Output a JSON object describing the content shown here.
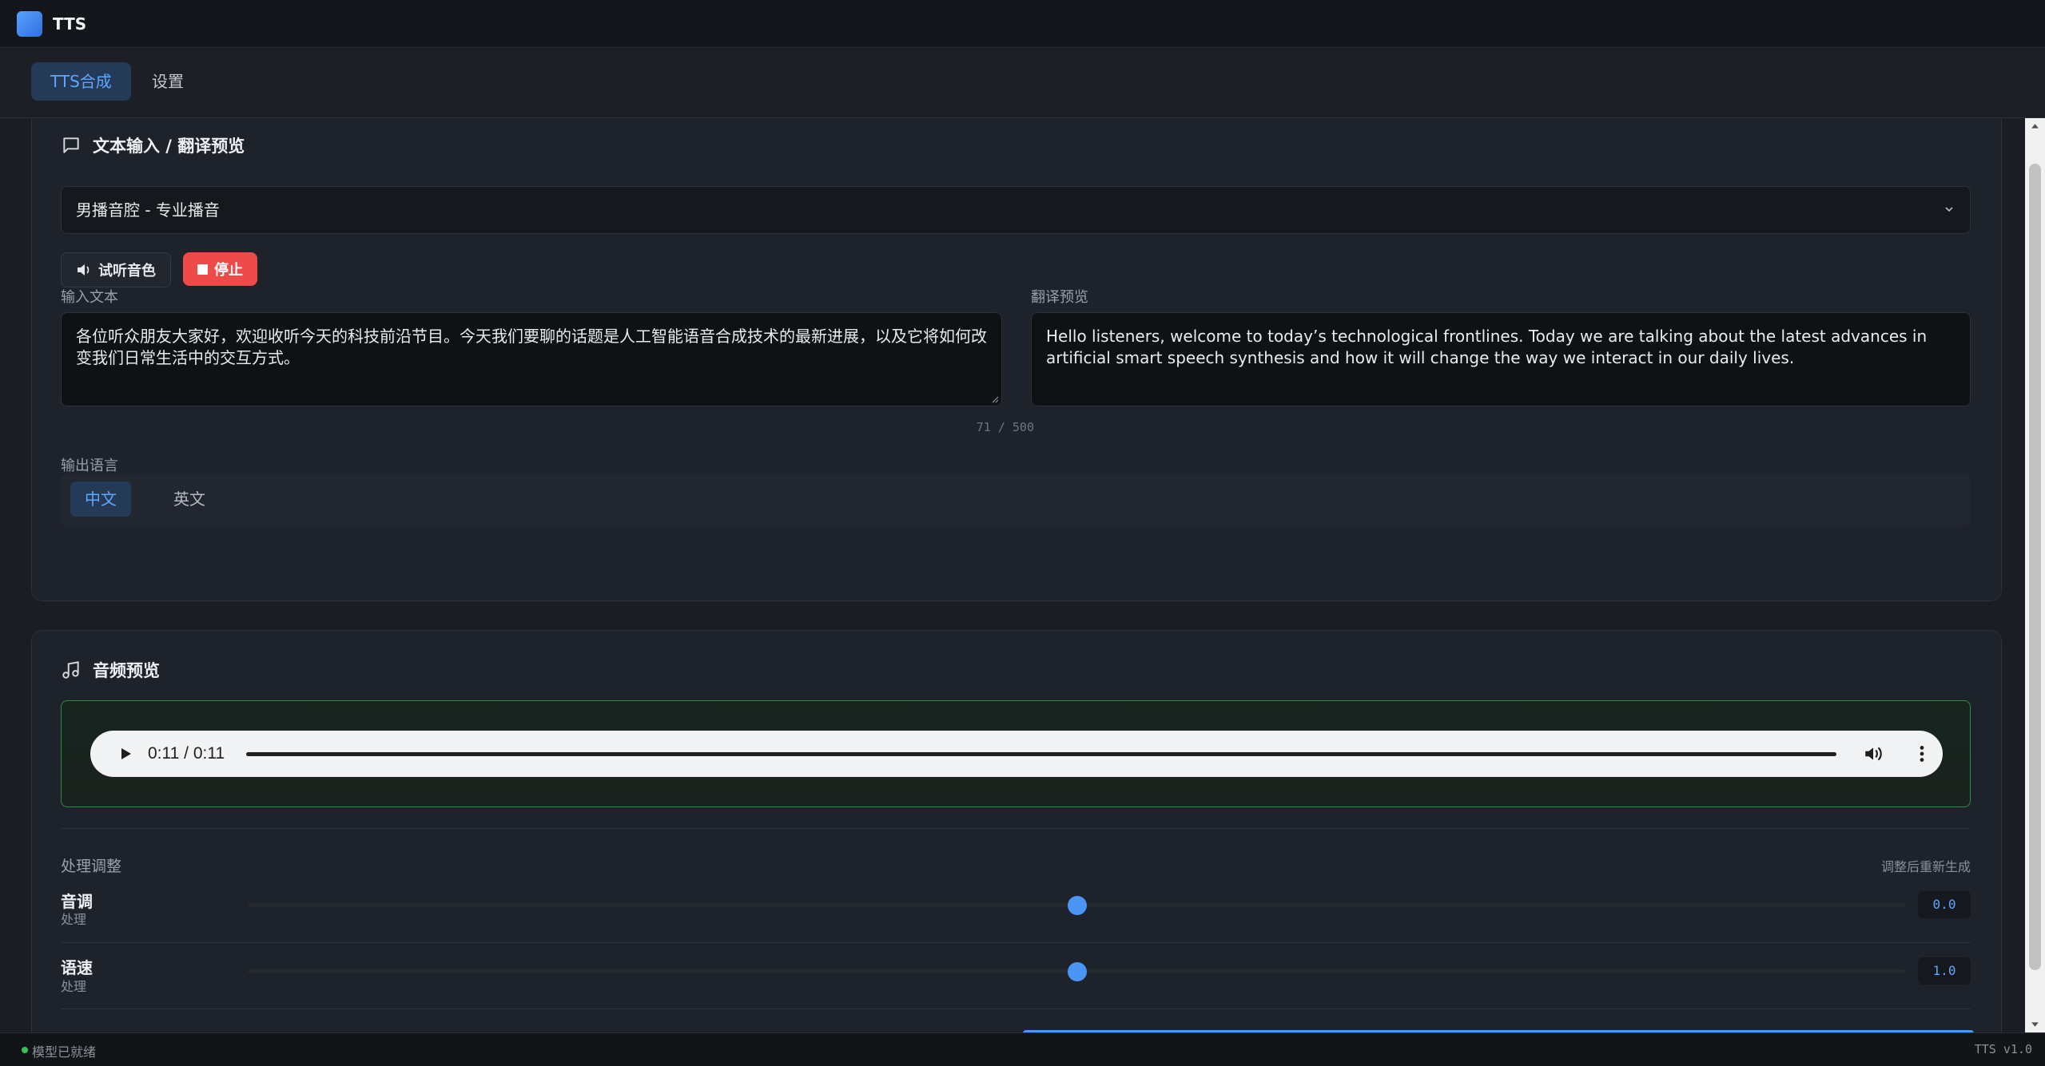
{
  "app": {
    "title": "TTS"
  },
  "tabs": [
    {
      "label": "TTS合成",
      "active": true
    },
    {
      "label": "设置",
      "active": false
    }
  ],
  "text_panel": {
    "title": "文本输入 / 翻译预览",
    "voice_selected": "男播音腔 - 专业播音",
    "listen_button": "试听音色",
    "stop_button": "停止",
    "input_label": "输入文本",
    "input_value": "各位听众朋友大家好，欢迎收听今天的科技前沿节目。今天我们要聊的话题是人工智能语音合成技术的最新进展，以及它将如何改变我们日常生活中的交互方式。",
    "char_count": "71 / 500",
    "translation_label": "翻译预览",
    "translation_value": "Hello listeners, welcome to today’s technological frontlines. Today we are talking about the latest advances in artificial smart speech synthesis and how it will change the way we interact in our daily lives.",
    "output_language_label": "输出语言",
    "languages": [
      {
        "label": "中文",
        "active": true
      },
      {
        "label": "英文",
        "active": false
      }
    ]
  },
  "audio_panel": {
    "title": "音频预览",
    "player_time": "0:11 / 0:11",
    "progress": 1.0,
    "processing_label": "处理调整",
    "processing_note": "调整后重新生成",
    "sliders": [
      {
        "name": "音调",
        "sub": "处理",
        "value": "0.0",
        "position": 0.5
      },
      {
        "name": "语速",
        "sub": "处理",
        "value": "1.0",
        "position": 0.5
      }
    ]
  },
  "status": {
    "text": "模型已就绪",
    "version": "TTS v1.0"
  },
  "colors": {
    "accent": "#4b95f5",
    "stop": "#ef4a4a",
    "ready": "#35c25a",
    "audio_border": "#2f8a47"
  }
}
